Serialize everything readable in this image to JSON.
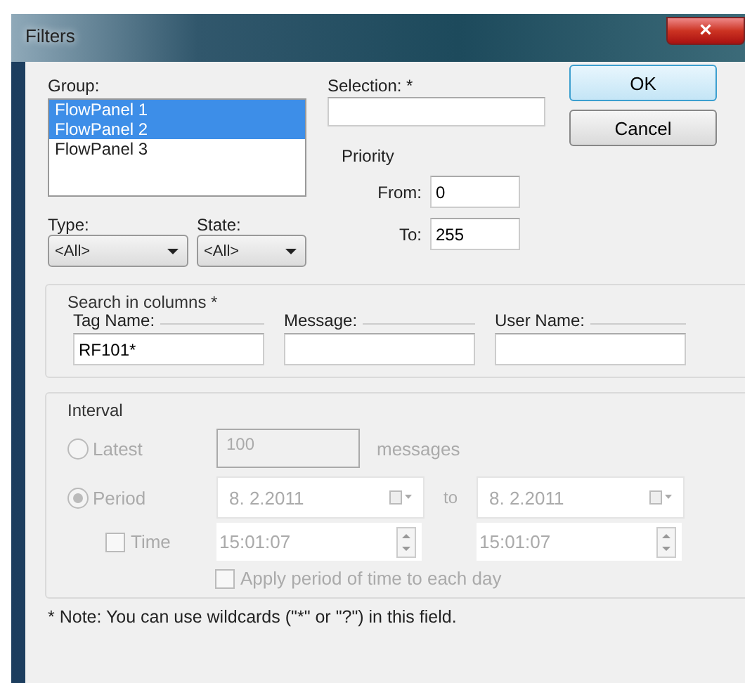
{
  "window": {
    "title": "Filters",
    "close": "×"
  },
  "group": {
    "label": "Group:",
    "items": [
      {
        "label": "FlowPanel 1",
        "selected": true
      },
      {
        "label": "FlowPanel 2",
        "selected": true
      },
      {
        "label": "FlowPanel 3",
        "selected": false
      }
    ]
  },
  "type": {
    "label": "Type:",
    "value": "<All>"
  },
  "state": {
    "label": "State:",
    "value": "<All>"
  },
  "selection": {
    "label": "Selection: *"
  },
  "priority": {
    "label": "Priority",
    "from_label": "From:",
    "from": "0",
    "to_label": "To:",
    "to": "255"
  },
  "buttons": [
    {
      "label": "OK",
      "default": true
    },
    {
      "label": "Cancel",
      "default": false
    }
  ],
  "search": {
    "title": "Search in columns *",
    "columns": [
      {
        "label": "Tag Name:",
        "value": "RF101*"
      },
      {
        "label": "Message:"
      },
      {
        "label": "User Name:"
      }
    ]
  },
  "interval": {
    "title": "Interval",
    "disabled": true,
    "latest": {
      "label": "Latest",
      "selected": false,
      "value": "100",
      "unit": "messages"
    },
    "period": {
      "label": "Period",
      "selected": true,
      "from": "8.  2.2011",
      "to_label": "to",
      "to": "8.  2.2011"
    },
    "time": {
      "label": "Time",
      "checked": false,
      "from": "15:01:07",
      "to": "15:01:07"
    },
    "apply": {
      "label": "Apply period of time to each day",
      "checked": false
    }
  },
  "note": "* Note: You can use wildcards (\"*\" or \"?\") in this field."
}
